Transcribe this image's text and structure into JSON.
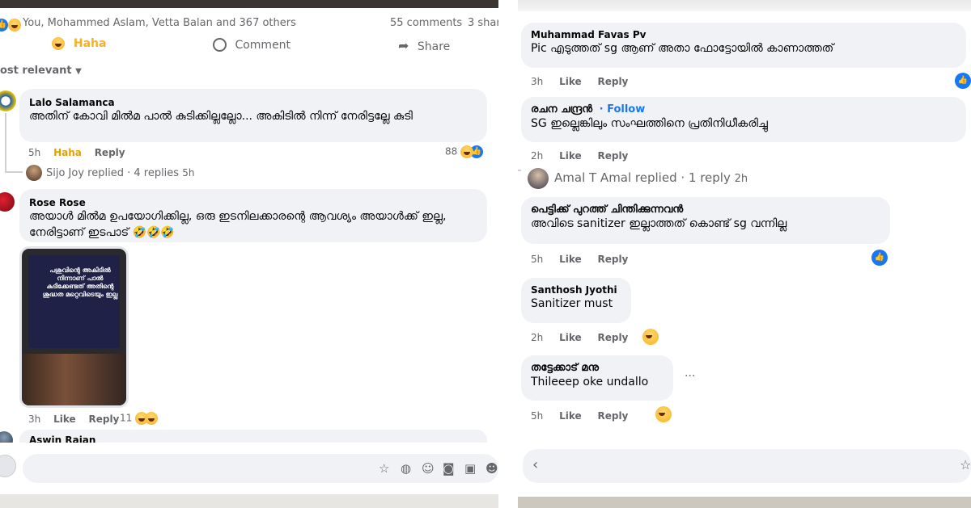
{
  "left": {
    "reactions_summary": "You, Mohammed Aslam, Vetta Balan and 367 others",
    "comments_count": "55 comments",
    "shares_count": "3 shar",
    "actions": {
      "haha": "Haha",
      "comment": "Comment",
      "share": "Share"
    },
    "sort_label": "ost relevant",
    "comments": [
      {
        "name": "Lalo Salamanca",
        "text": "അതിന് കോവി മിൽമ പാൽ കുടിക്കില്ലല്ലോ... അകിടിൽ നിന്ന് നേരിട്ടല്ലേ കുടി",
        "time": "5h",
        "reaction_label": "Haha",
        "reply": "Reply",
        "count": "88"
      },
      {
        "name": "Rose Rose",
        "text": "അയാൾ മിൽമ ഉപയോഗിക്കില്ല, ഒരു ഇടനിലക്കാരന്റെ ആവശ്യം അയാൾക്ക് ഇല്ല, നേരിട്ടാണ് ഇടപാട് 🤣🤣🤣",
        "time": "3h",
        "like": "Like",
        "reply": "Reply",
        "count": "11",
        "poster_text": "പശുവിന്റെ അകിടിൽ നിന്നാണ് പാൽ കുടിക്കേണ്ടത് അതിന്റെ ശുദ്ധത മറ്റെവിടെയും ഇല്ല"
      },
      {
        "name": "Aswin Rajan"
      }
    ],
    "replies_line": "Sijo Joy replied · 4 replies",
    "replies_time": "5h"
  },
  "right": {
    "comments": [
      {
        "name": "Muhammad Favas Pv",
        "text": "Pic എടുത്തത് sg ആണ് അതാ ഫോട്ടോയിൽ കാണാത്തത്",
        "time": "3h",
        "like": "Like",
        "reply": "Reply"
      },
      {
        "name": "രചന ചന്ദ്രൻ",
        "follow": "· Follow",
        "text": "SG ഇല്ലെങ്കിലും സംഘത്തിനെ പ്രതിനിധീകരിച്ചു",
        "time": "2h",
        "like": "Like",
        "reply": "Reply"
      },
      {
        "name": "പെട്ടിക്ക് പുറത്ത് ചിന്തിക്കുന്നവൻ",
        "text": "അവിടെ sanitizer ഇല്ലാത്തത് കൊണ്ട് sg വന്നില്ല",
        "time": "5h",
        "like": "Like",
        "reply": "Reply"
      },
      {
        "name": "Santhosh Jyothi",
        "text": "Sanitizer must",
        "time": "2h",
        "like": "Like",
        "reply": "Reply"
      },
      {
        "name": "തട്ടേക്കാട് മനു",
        "text": "Thileeep oke undallo",
        "time": "5h",
        "like": "Like",
        "reply": "Reply",
        "more": "···"
      }
    ],
    "replied_line": "Amal T Amal replied · 1 reply",
    "replied_time": "2h"
  },
  "colors": {
    "blue": "#1877f2",
    "bubble": "#f0f2f5",
    "meta": "#65676b",
    "haha": "#f7b125"
  }
}
